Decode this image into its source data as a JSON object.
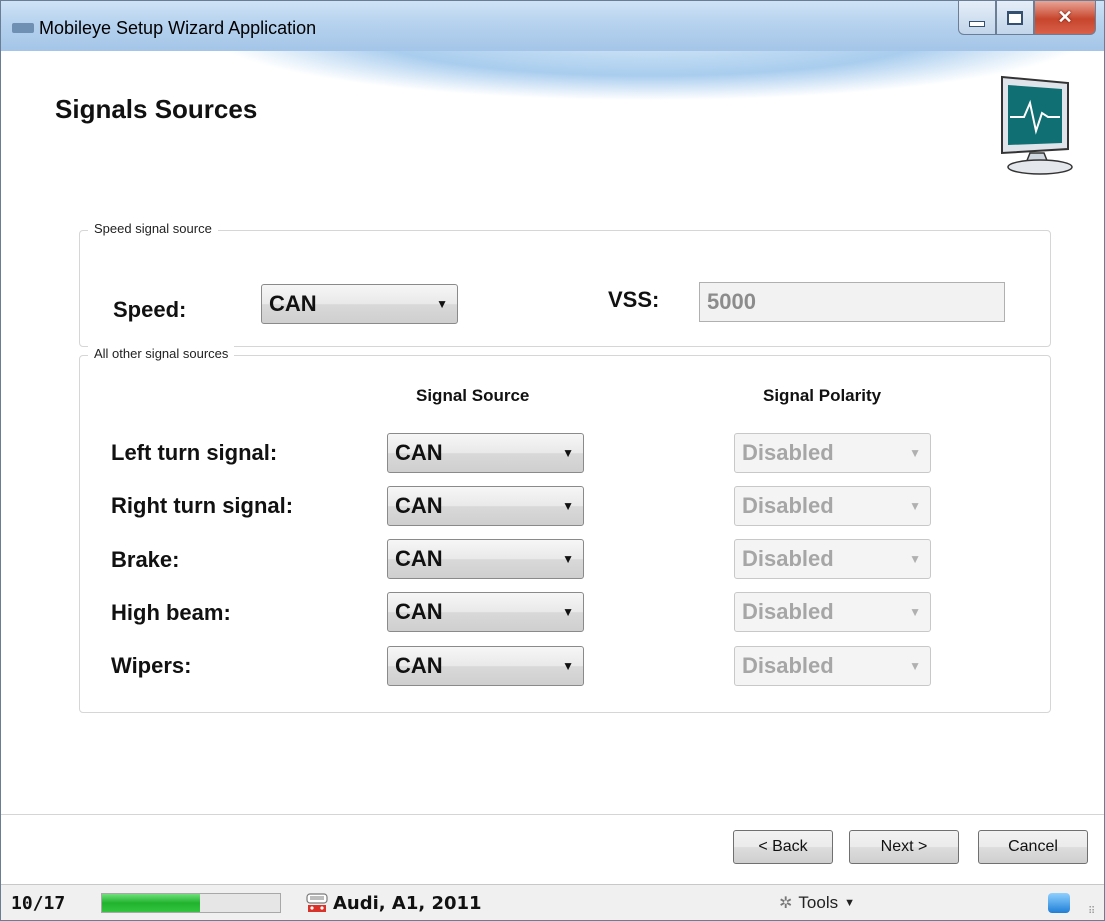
{
  "window": {
    "title": "Mobileye Setup Wizard Application"
  },
  "page": {
    "title": "Signals Sources"
  },
  "speed_group": {
    "legend": "Speed signal source",
    "speed_label": "Speed:",
    "speed_value": "CAN",
    "vss_label": "VSS:",
    "vss_value": "5000"
  },
  "other_group": {
    "legend": "All other signal sources",
    "col_source": "Signal Source",
    "col_polarity": "Signal Polarity",
    "rows": [
      {
        "label": "Left turn signal:",
        "source": "CAN",
        "polarity": "Disabled"
      },
      {
        "label": "Right turn signal:",
        "source": "CAN",
        "polarity": "Disabled"
      },
      {
        "label": "Brake:",
        "source": "CAN",
        "polarity": "Disabled"
      },
      {
        "label": "High beam:",
        "source": "CAN",
        "polarity": "Disabled"
      },
      {
        "label": "Wipers:",
        "source": "CAN",
        "polarity": "Disabled"
      }
    ]
  },
  "buttons": {
    "back": "< Back",
    "next": "Next >",
    "cancel": "Cancel"
  },
  "status": {
    "step": "10/17",
    "progress_fraction": 0.55,
    "vehicle": "Audi, A1, 2011",
    "tools": "Tools"
  },
  "colors": {
    "progress": "#21b32d",
    "titlebar": "#b6d2ee",
    "close_button": "#c7452c"
  },
  "icons": [
    "app-icon",
    "monitor-icon",
    "car-icon",
    "tools-icon",
    "teamviewer-icon"
  ]
}
